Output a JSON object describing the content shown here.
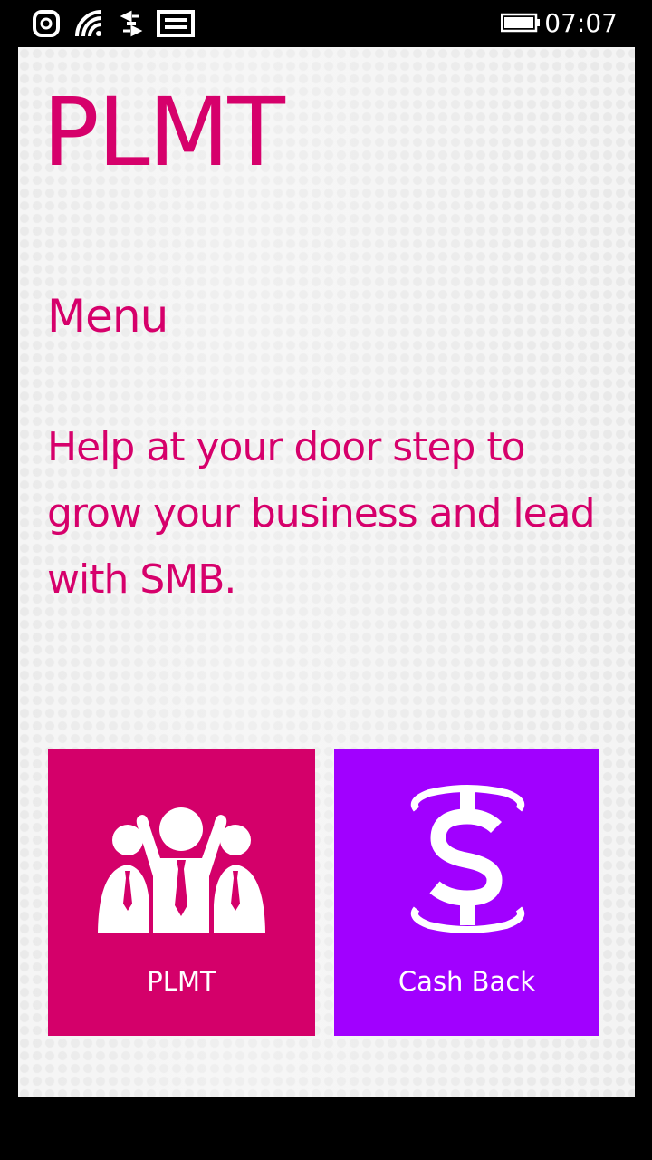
{
  "status_bar": {
    "time": "07:07",
    "icons": [
      "nfc-icon",
      "wifi-icon",
      "data-sync-icon",
      "message-icon",
      "battery-icon"
    ]
  },
  "app": {
    "title": "PLMT",
    "section_title": "Menu",
    "tagline": "Help at your door step to grow your business and lead with SMB."
  },
  "tiles": [
    {
      "label": "PLMT",
      "icon": "team-celebrating-icon",
      "color": "#d4006a"
    },
    {
      "label": "Cash Back",
      "icon": "cash-back-dollar-icon",
      "color": "#a100ff"
    }
  ],
  "colors": {
    "accent": "#d6006b",
    "background": "#f4f4f4"
  }
}
